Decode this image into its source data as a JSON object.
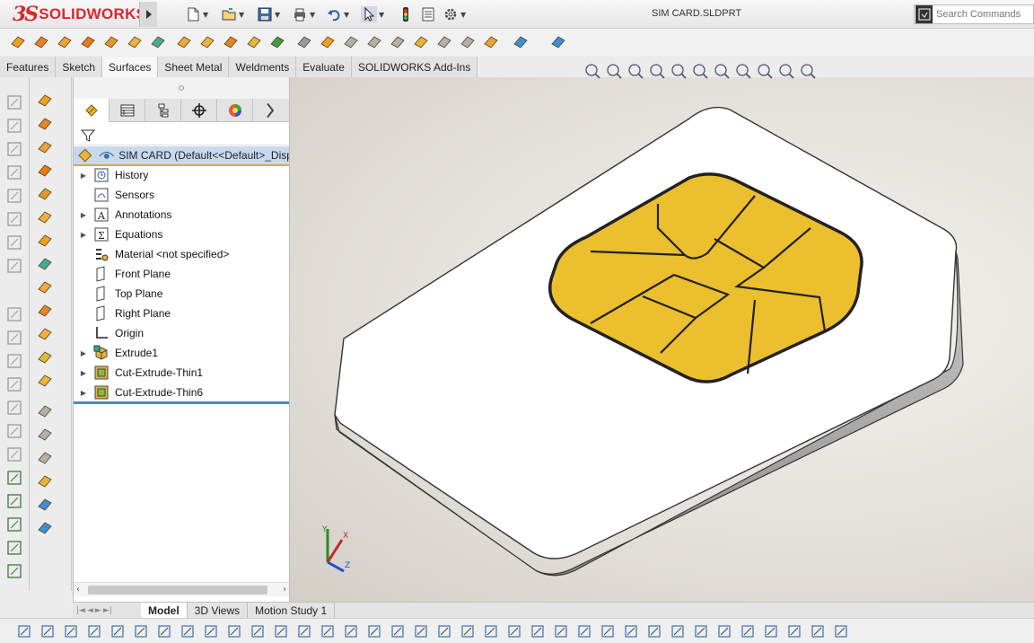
{
  "app": {
    "logo_prefix": "3S",
    "logo_name": "SOLIDWORKS",
    "document_title": "SIM CARD.SLDPRT"
  },
  "search": {
    "placeholder": "Search Commands"
  },
  "ribbon_tabs": [
    "Features",
    "Sketch",
    "Surfaces",
    "Sheet Metal",
    "Weldments",
    "Evaluate",
    "SOLIDWORKS Add-Ins"
  ],
  "active_ribbon_tab": "Surfaces",
  "feature_manager": {
    "root_label": "SIM CARD  (Default<<Default>_Disp",
    "items": [
      {
        "label": "History",
        "expandable": true,
        "icon": "history-icon"
      },
      {
        "label": "Sensors",
        "expandable": false,
        "icon": "sensors-icon"
      },
      {
        "label": "Annotations",
        "expandable": true,
        "icon": "annotations-icon"
      },
      {
        "label": "Equations",
        "expandable": true,
        "icon": "equations-icon"
      },
      {
        "label": "Material <not specified>",
        "expandable": false,
        "icon": "material-icon"
      },
      {
        "label": "Front Plane",
        "expandable": false,
        "icon": "plane-icon"
      },
      {
        "label": "Top Plane",
        "expandable": false,
        "icon": "plane-icon"
      },
      {
        "label": "Right Plane",
        "expandable": false,
        "icon": "plane-icon"
      },
      {
        "label": "Origin",
        "expandable": false,
        "icon": "origin-icon"
      },
      {
        "label": "Extrude1",
        "expandable": true,
        "icon": "extrude-icon"
      },
      {
        "label": "Cut-Extrude-Thin1",
        "expandable": true,
        "icon": "cut-extrude-icon"
      },
      {
        "label": "Cut-Extrude-Thin6",
        "expandable": true,
        "icon": "cut-extrude-icon"
      }
    ]
  },
  "bottom_tabs": [
    "Model",
    "3D Views",
    "Motion Study 1"
  ],
  "active_bottom_tab": "Model",
  "triad": {
    "x": "X",
    "y": "Y",
    "z": "Z"
  },
  "colors": {
    "brand_red": "#d7282f",
    "chip_gold": "#ecbf2e",
    "card_white": "#ffffff",
    "selection_blue": "#c6d9ef",
    "rollback_bar": "#4a8bc8"
  }
}
